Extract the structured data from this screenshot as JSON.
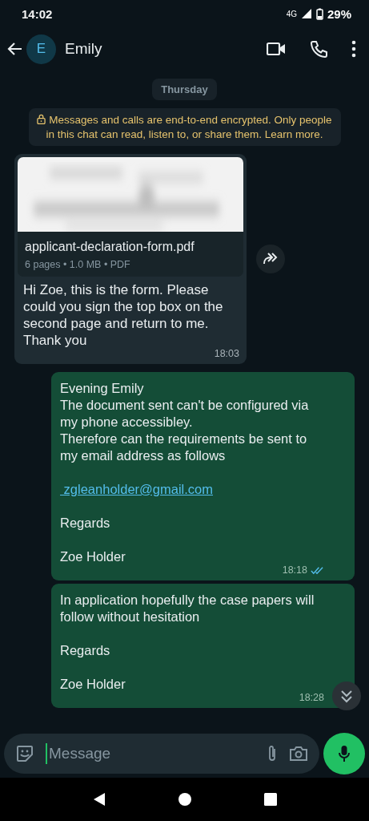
{
  "status_bar": {
    "time": "14:02",
    "network": "4G",
    "battery": "29%"
  },
  "header": {
    "avatar_letter": "E",
    "contact": "Emily"
  },
  "date_chip": "Thursday",
  "encryption_notice": "Messages and calls are end-to-end encrypted. Only people in this chat can read, listen to, or share them. Learn more.",
  "messages": [
    {
      "kind": "document",
      "outgoing": false,
      "file_name": "applicant-declaration-form.pdf",
      "file_meta": "6 pages • 1.0 MB • PDF",
      "paragraphs": [
        {
          "kind": "text",
          "lines": [
            "Hi Zoe, this is the form. Please could you sign the top box on the second page and return to me. Thank you"
          ]
        }
      ],
      "time": "18:03"
    },
    {
      "kind": "text",
      "outgoing": true,
      "paragraphs": [
        {
          "kind": "text",
          "lines": [
            "Evening Emily",
            "The document sent can't be configured via my phone accessibley.",
            "Therefore can the requirements be sent to my email address as follows"
          ]
        },
        {
          "kind": "link",
          "lines": [
            " zgleanholder@gmail.com"
          ]
        },
        {
          "kind": "text",
          "lines": [
            "Regards"
          ]
        },
        {
          "kind": "text",
          "lines": [
            "Zoe Holder"
          ]
        }
      ],
      "time": "18:18",
      "read": true
    },
    {
      "kind": "text",
      "outgoing": true,
      "paragraphs": [
        {
          "kind": "text",
          "lines": [
            "In application hopefully the case papers will follow without  hesitation"
          ]
        },
        {
          "kind": "text",
          "lines": [
            "Regards"
          ]
        },
        {
          "kind": "text",
          "lines": [
            "Zoe Holder"
          ]
        }
      ],
      "time": "18:28",
      "read": false
    }
  ],
  "composer": {
    "placeholder": "Message"
  }
}
